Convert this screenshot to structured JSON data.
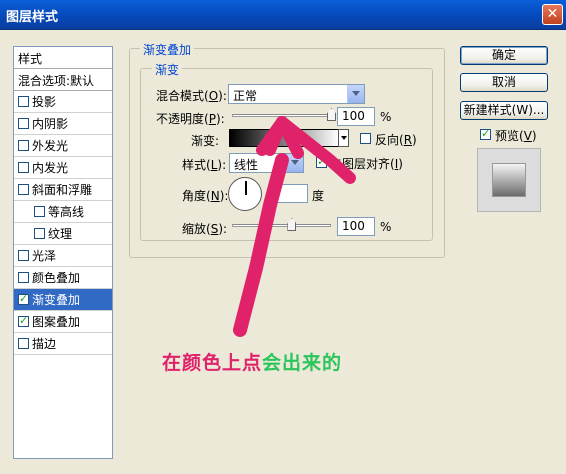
{
  "window": {
    "title": "图层样式"
  },
  "left_list": {
    "header": "样式",
    "blend_options": "混合选项:默认",
    "items": [
      {
        "label": "投影",
        "checked": false
      },
      {
        "label": "内阴影",
        "checked": false
      },
      {
        "label": "外发光",
        "checked": false
      },
      {
        "label": "内发光",
        "checked": false
      },
      {
        "label": "斜面和浮雕",
        "checked": false
      },
      {
        "label": "等高线",
        "checked": false,
        "indent": true
      },
      {
        "label": "纹理",
        "checked": false,
        "indent": true
      },
      {
        "label": "光泽",
        "checked": false
      },
      {
        "label": "颜色叠加",
        "checked": false
      },
      {
        "label": "渐变叠加",
        "checked": true,
        "selected": true
      },
      {
        "label": "图案叠加",
        "checked": true
      },
      {
        "label": "描边",
        "checked": false
      }
    ]
  },
  "panel": {
    "group_title": "渐变叠加",
    "sub_title": "渐变",
    "blend_mode": {
      "label": "混合模式",
      "key": "O",
      "value": "正常"
    },
    "opacity": {
      "label": "不透明度",
      "key": "P",
      "value": "100",
      "unit": "%",
      "level": 1.0
    },
    "gradient": {
      "label": "渐变:"
    },
    "reverse": {
      "label": "反向",
      "key": "R",
      "checked": false
    },
    "style": {
      "label": "样式",
      "key": "L",
      "value": "线性"
    },
    "align_layer": {
      "label": "与图层对齐",
      "key": "I",
      "checked": true
    },
    "angle": {
      "label": "角度",
      "key": "N",
      "value": "",
      "unit": "度"
    },
    "scale": {
      "label": "缩放",
      "key": "S",
      "value": "100",
      "unit": "%",
      "level": 1.0
    }
  },
  "buttons": {
    "ok": "确定",
    "cancel": "取消",
    "new_style": "新建样式(W)...",
    "preview": {
      "label": "预览",
      "key": "V",
      "checked": true
    }
  },
  "annotation": {
    "part1": "在颜色上点",
    "part2": "会出来的",
    "color1": "#e0226a",
    "color2": "#2bc55b"
  }
}
